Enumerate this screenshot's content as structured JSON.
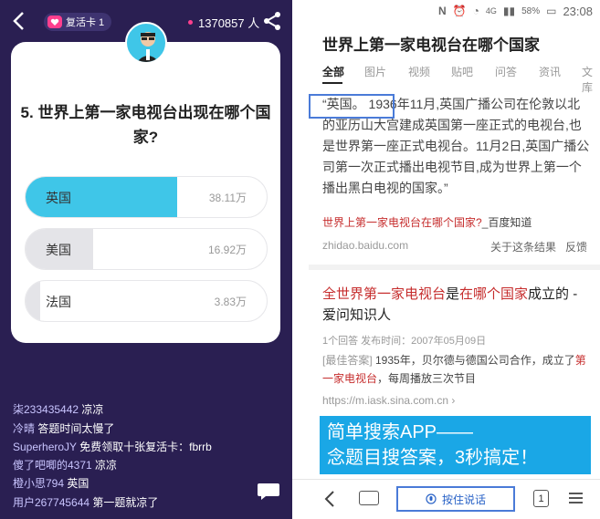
{
  "left": {
    "revive_card": "复活卡 1",
    "viewer_count": "1370857 人",
    "question": "5. 世界上第一家电视台出现在哪个国家?",
    "options": [
      {
        "label": "英国",
        "count": "38.11万",
        "share": 0.63,
        "chosen": true
      },
      {
        "label": "美国",
        "count": "16.92万",
        "share": 0.28,
        "chosen": false
      },
      {
        "label": "法国",
        "count": "3.83万",
        "share": 0.06,
        "chosen": false
      }
    ],
    "chat": [
      {
        "user": "柒233435442",
        "text": "凉凉"
      },
      {
        "user": "冷晴",
        "text": "答题时间太慢了"
      },
      {
        "user": "SuperheroJY",
        "text": "免费领取十张复活卡：fbrrb"
      },
      {
        "user": "傻了吧唧的4371",
        "text": "凉凉"
      },
      {
        "user": "橙小思794",
        "text": "英国"
      },
      {
        "user": "用户267745644",
        "text": "第一题就凉了"
      }
    ]
  },
  "right": {
    "status": {
      "battery": "58%",
      "time": "23:08",
      "net": "4G"
    },
    "search_title": "世界上第一家电视台在哪个国家",
    "tabs": [
      "全部",
      "图片",
      "视频",
      "贴吧",
      "问答",
      "资讯",
      "文库"
    ],
    "answer_text": "“英国。 1936年11月,英国广播公司在伦敦以北的亚历山大宫建成英国第一座正式的电视台,也是世界第一座正式电视台。11月2日,英国广播公司第一次正式播出电视节目,成为世界上第一个播出黑白电视的国家。”",
    "result1": {
      "link": "世界上第一家电视台在哪个国家?",
      "suffix": "_百度知道",
      "url": "zhidao.baidu.com",
      "about": "关于这条结果",
      "feedback": "反馈"
    },
    "result2": {
      "t1": "全世界第一家电视台",
      "t2": "是",
      "t3": "在哪个国家",
      "t4": "成立的 - 爱问知识人",
      "meta": "1个回答   发布时间：2007年05月09日",
      "tag": "[最佳答案]",
      "snip_a": "  1935年，贝尔德与德国公司合作，成立了",
      "snip_b": "第一家电视台",
      "snip_c": "，每周播放三次节目",
      "url": "https://m.iask.sina.com.cn ›"
    },
    "ad": {
      "line1": "简单搜索APP——",
      "line2": "念题目搜答案，3秒搞定！"
    },
    "bottom": {
      "voice": "按住说话",
      "tab_count": "1"
    }
  }
}
